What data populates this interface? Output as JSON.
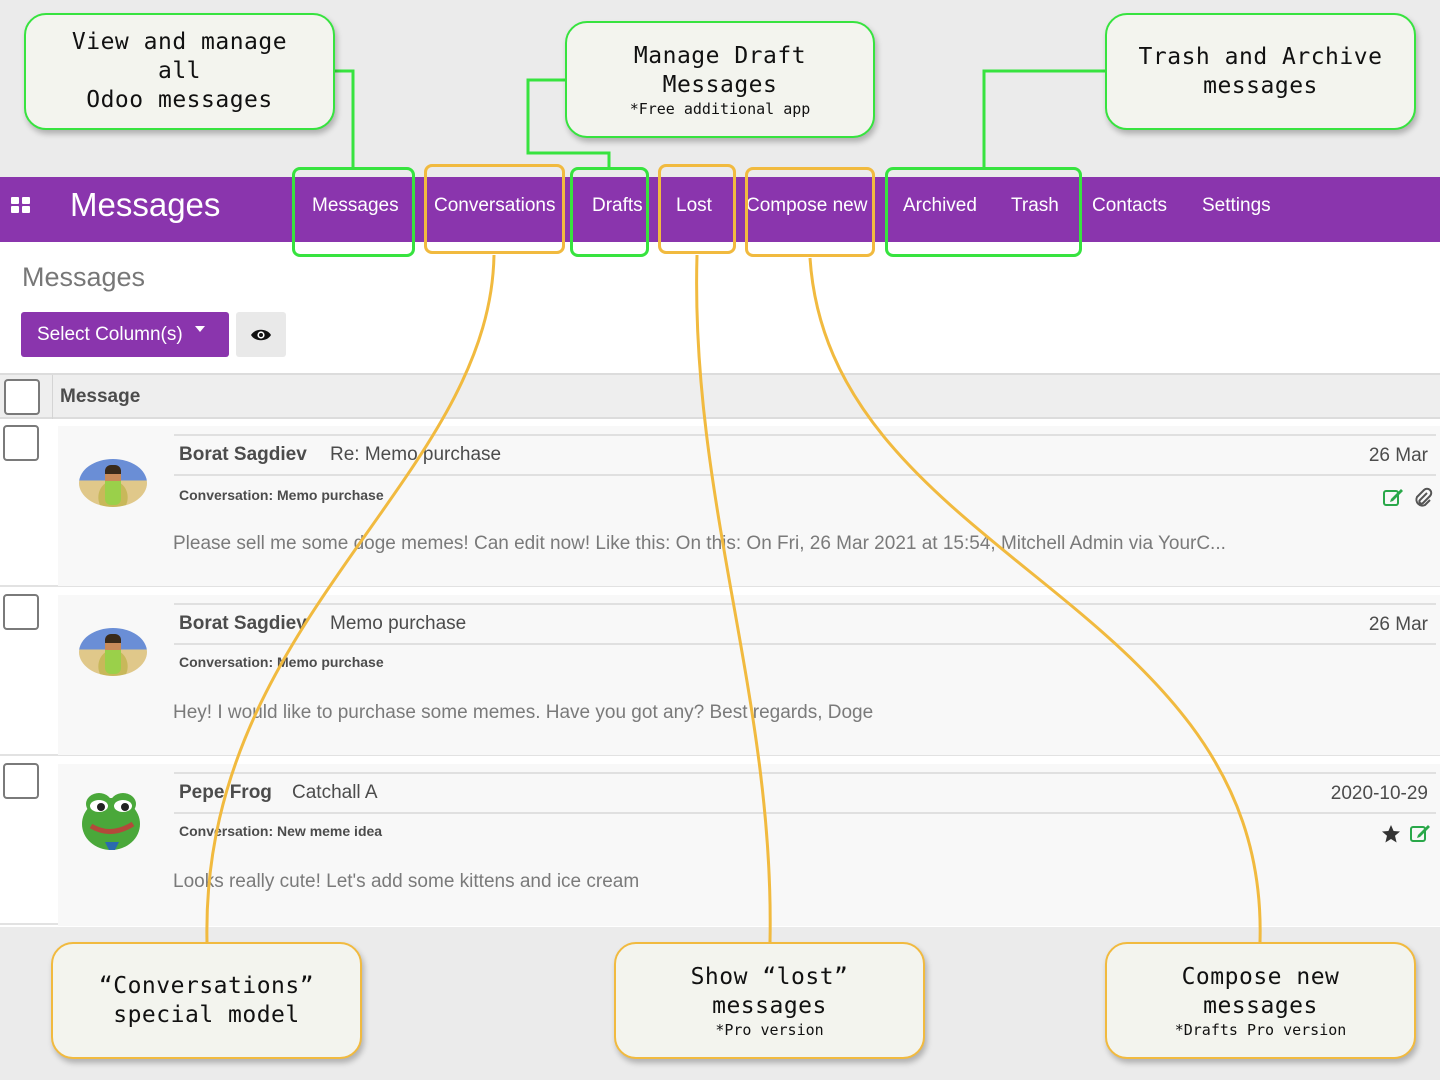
{
  "navbar": {
    "brand": "Messages",
    "items": [
      "Messages",
      "Conversations",
      "Drafts",
      "Lost",
      "Compose new",
      "Archived",
      "Trash",
      "Contacts",
      "Settings"
    ]
  },
  "page": {
    "title": "Messages",
    "select_columns_label": "Select Column(s)",
    "column_header": "Message"
  },
  "messages": [
    {
      "author": "Borat Sagdiev",
      "subject": "Re: Memo purchase",
      "date": "26 Mar",
      "conversation": "Conversation: Memo purchase",
      "preview": "Please sell me some doge memes! Can edit now! Like this: On this: On Fri, 26 Mar 2021 at 15:54, Mitchell Admin via YourC...",
      "icons": [
        "edit-icon",
        "paperclip-icon"
      ]
    },
    {
      "author": "Borat Sagdiev",
      "subject": "Memo purchase",
      "date": "26 Mar",
      "conversation": "Conversation: Memo purchase",
      "preview": "Hey! I would like to purchase some memes. Have you got any? Best regards, Doge",
      "icons": []
    },
    {
      "author": "Pepe Frog",
      "subject": "Catchall A",
      "date": "2020-10-29",
      "conversation": "Conversation: New meme idea",
      "preview": "Looks really cute! Let's add some kittens and ice cream",
      "icons": [
        "star-icon",
        "edit-icon"
      ]
    }
  ],
  "callouts": {
    "view_manage": "View and manage\nall\nOdoo messages",
    "drafts_main": "Manage Draft\nMessages",
    "drafts_sub": "*Free additional app",
    "trash_archive": "Trash and Archive\nmessages",
    "conversations": "“Conversations”\nspecial model",
    "lost_main": "Show “lost”\nmessages",
    "lost_sub": "*Pro version",
    "compose_main": "Compose new\nmessages",
    "compose_sub": "*Drafts Pro version"
  },
  "colors": {
    "navbar": "#8a35ad",
    "green_highlight": "#37e33f",
    "orange_highlight": "#f1ba3f",
    "icon_green": "#2aa84a"
  }
}
